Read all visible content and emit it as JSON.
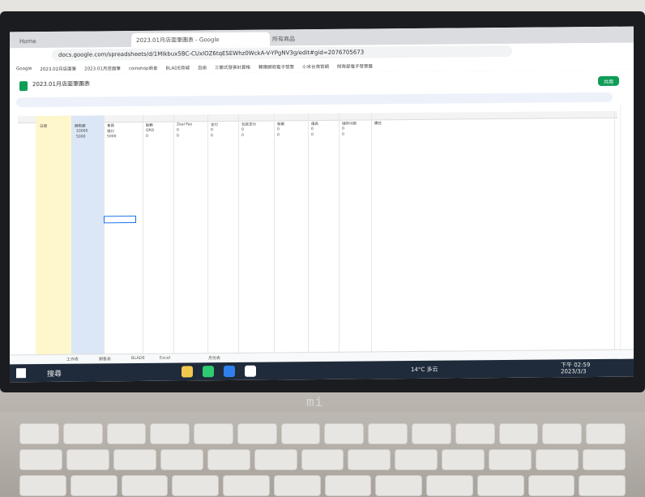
{
  "browser": {
    "tabs": [
      "Home",
      "2023.01月店面筆圖表 - Google",
      "所有商品"
    ],
    "url": "docs.google.com/spreadsheets/d/1MIkbux5BC-CUxlOZ6tqESEWhz0WckA-V-YPgNV3g/edit#gid=2076705673",
    "bookmarks": [
      "Google",
      "2023.02月店面筆",
      "2023.01月店面筆",
      "coinshop商會",
      "BLADE商城",
      "自由",
      "三聯式發票計算格",
      "賴爾網商電子發票",
      "小米台灣官網",
      "財政部電子發票整"
    ]
  },
  "sheet": {
    "title": "2023.01月店面筆圖表",
    "share_label": "共用",
    "columns": [
      "日期",
      "銷售額",
      "會員",
      "點數",
      "Zeal Pay",
      "支付",
      "包裝支付",
      "發票",
      "儀表",
      "儲存付款",
      "備註"
    ],
    "rows": [
      [
        "",
        "10000",
        "現付",
        "QRD",
        "0",
        "0",
        "0",
        "0",
        "0",
        "0",
        ""
      ],
      [
        "",
        "5000",
        "5000",
        "0",
        "0",
        "0",
        "0",
        "0",
        "0",
        "0",
        ""
      ]
    ],
    "sheet_tabs": [
      "工作表",
      "銷售表",
      "BLADE",
      "Excel",
      "月份表"
    ]
  },
  "taskbar": {
    "search": "搜尋",
    "weather": "14°C 多云",
    "time": "下午 02:59",
    "date": "2023/3/3"
  },
  "device": {
    "brand": "mi"
  }
}
